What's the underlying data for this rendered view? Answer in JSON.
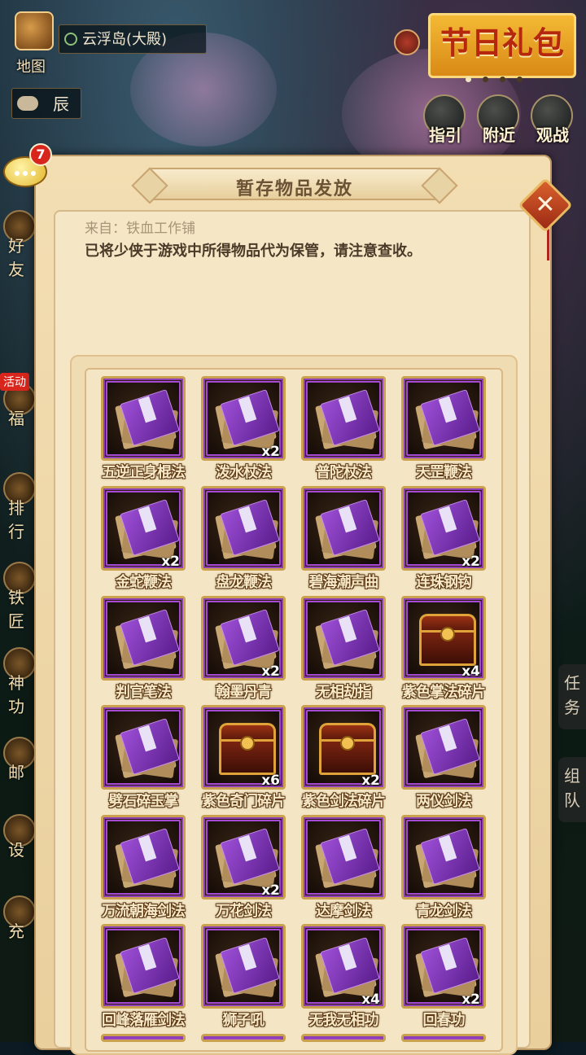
{
  "hud": {
    "map_label": "地图",
    "location": "云浮岛(大殿)",
    "time": "辰",
    "gift_banner": "节日礼包",
    "round_buttons": [
      {
        "label": "指引",
        "icon": "fist-icon"
      },
      {
        "label": "附近",
        "icon": "pin-icon"
      },
      {
        "label": "观战",
        "icon": "camera-icon"
      }
    ],
    "left_side": [
      "好友",
      "福",
      "排行",
      "铁匠",
      "神功",
      "邮",
      "设",
      "充"
    ],
    "right_side": [
      "任务",
      "组队"
    ],
    "chat_badge": "7",
    "activity_tag": "活动"
  },
  "dialog": {
    "title": "暂存物品发放",
    "from": "来自：铁血工作铺",
    "message": "已将少侠于游戏中所得物品代为保管，请注意查收。",
    "items": [
      {
        "name": "五逆正身棍法",
        "qty": "",
        "type": "book"
      },
      {
        "name": "泼水杖法",
        "qty": "x2",
        "type": "book"
      },
      {
        "name": "普陀杖法",
        "qty": "",
        "type": "book"
      },
      {
        "name": "天罡鞭法",
        "qty": "",
        "type": "book"
      },
      {
        "name": "金蛇鞭法",
        "qty": "x2",
        "type": "book"
      },
      {
        "name": "盘龙鞭法",
        "qty": "",
        "type": "book"
      },
      {
        "name": "碧海潮声曲",
        "qty": "",
        "type": "book"
      },
      {
        "name": "连珠钢钩",
        "qty": "x2",
        "type": "book"
      },
      {
        "name": "判官笔法",
        "qty": "",
        "type": "book"
      },
      {
        "name": "翰墨丹青",
        "qty": "x2",
        "type": "book"
      },
      {
        "name": "无相劫指",
        "qty": "",
        "type": "book"
      },
      {
        "name": "紫色掌法碎片",
        "qty": "x4",
        "type": "chest"
      },
      {
        "name": "劈石碎玉掌",
        "qty": "",
        "type": "book"
      },
      {
        "name": "紫色奇门碎片",
        "qty": "x6",
        "type": "chest"
      },
      {
        "name": "紫色剑法碎片",
        "qty": "x2",
        "type": "chest"
      },
      {
        "name": "两仪剑法",
        "qty": "",
        "type": "book"
      },
      {
        "name": "万流朝海剑法",
        "qty": "",
        "type": "book"
      },
      {
        "name": "万花剑法",
        "qty": "x2",
        "type": "book"
      },
      {
        "name": "达摩剑法",
        "qty": "",
        "type": "book"
      },
      {
        "name": "青龙剑法",
        "qty": "",
        "type": "book"
      },
      {
        "name": "回峰落雁剑法",
        "qty": "",
        "type": "book"
      },
      {
        "name": "狮子吼",
        "qty": "",
        "type": "book"
      },
      {
        "name": "无我无相功",
        "qty": "x4",
        "type": "book"
      },
      {
        "name": "回春功",
        "qty": "x2",
        "type": "book"
      }
    ],
    "partial_row_types": [
      "book",
      "book",
      "book",
      "book"
    ]
  },
  "colors": {
    "rarity_purple": "#a64ad6",
    "slot_gold": "#c9a14f",
    "close_red": "#c0401e"
  }
}
